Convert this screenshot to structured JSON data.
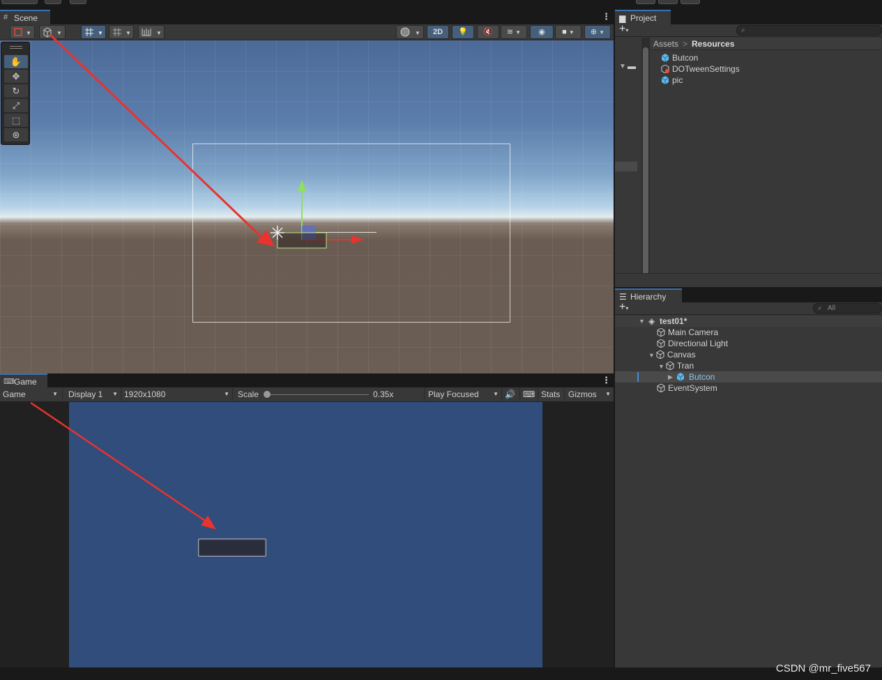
{
  "scene": {
    "tab_label": "Scene",
    "toolbar": {
      "mode_2d_label": "2D"
    },
    "tools": [
      "hand-icon",
      "move-icon",
      "rotate-icon",
      "scale-icon",
      "rect-icon",
      "transform-icon"
    ]
  },
  "game": {
    "tab_label": "Game",
    "mode_label": "Game",
    "display_label": "Display 1",
    "resolution_label": "1920x1080",
    "scale_label": "Scale",
    "scale_value": "0.35x",
    "play_mode_label": "Play Focused",
    "stats_label": "Stats",
    "gizmos_label": "Gizmos"
  },
  "project": {
    "tab_label": "Project",
    "breadcrumb": {
      "root": "Assets",
      "separator": ">",
      "current": "Resources"
    },
    "assets": [
      {
        "name": "Butcon",
        "icon": "prefab-cube-icon"
      },
      {
        "name": "DOTweenSettings",
        "icon": "scriptable-object-icon"
      },
      {
        "name": "pic",
        "icon": "prefab-cube-icon"
      }
    ]
  },
  "hierarchy": {
    "tab_label": "Hierarchy",
    "search_placeholder": "All",
    "scene_name": "test01*",
    "items": [
      {
        "name": "Main Camera"
      },
      {
        "name": "Directional Light"
      },
      {
        "name": "Canvas"
      },
      {
        "name": "Tran"
      },
      {
        "name": "Butcon"
      },
      {
        "name": "EventSystem"
      }
    ]
  },
  "watermark": "CSDN @mr_five567",
  "colors": {
    "accent": "#3a72b0",
    "selected_tool": "#46607c",
    "game_background": "#304d7b",
    "annotation_arrow": "#e8332e"
  }
}
